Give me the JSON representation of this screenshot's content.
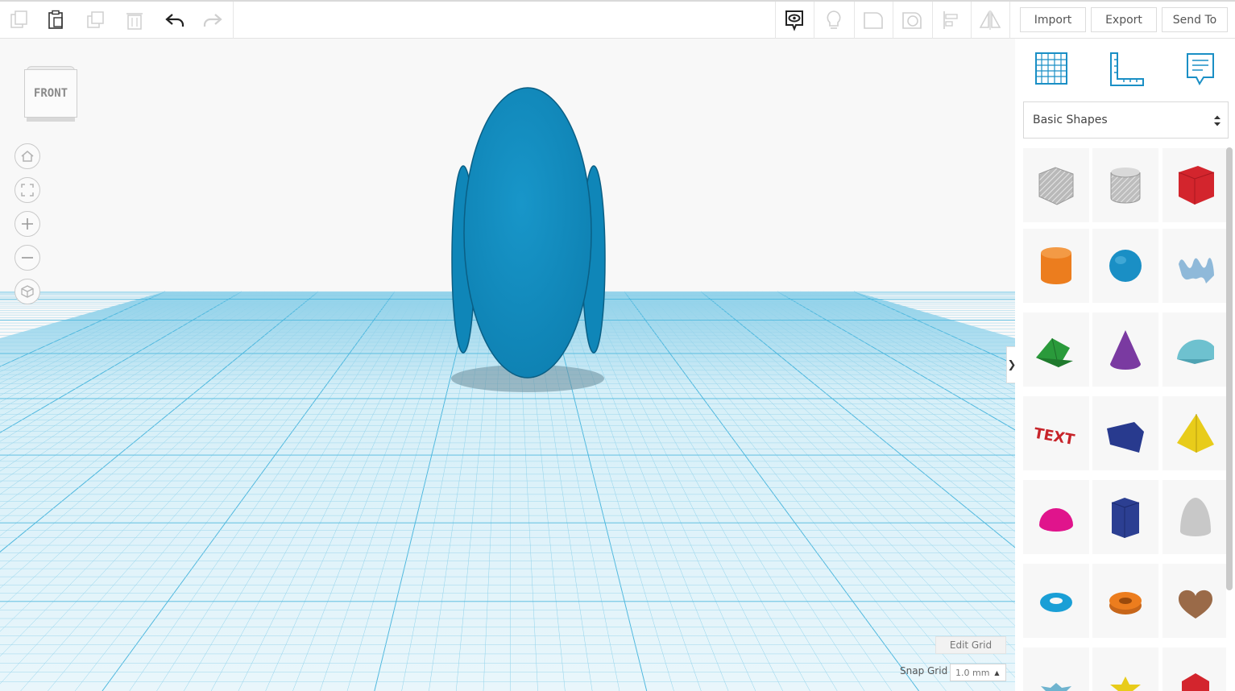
{
  "toolbar": {
    "left_icons": [
      "copy-icon",
      "paste-icon",
      "duplicate-icon",
      "trash-icon",
      "undo-icon",
      "redo-icon"
    ],
    "right_icons": [
      "view-notes-icon",
      "lightbulb-icon",
      "shape-icon",
      "hole-icon",
      "align-icon",
      "mirror-icon"
    ],
    "import_label": "Import",
    "export_label": "Export",
    "send_label": "Send To"
  },
  "viewcube": {
    "label": "FRONT"
  },
  "nav_buttons": [
    "home-icon",
    "fit-view-icon",
    "zoom-in-icon",
    "zoom-out-icon",
    "perspective-icon"
  ],
  "panel": {
    "category": "Basic Shapes",
    "collapse_glyph": "❯",
    "shapes": [
      {
        "name": "box-hole",
        "color": "#b9b9b9"
      },
      {
        "name": "cylinder-hole",
        "color": "#bdbdbd"
      },
      {
        "name": "box",
        "color": "#d3252d"
      },
      {
        "name": "cylinder",
        "color": "#ec7d1e"
      },
      {
        "name": "sphere",
        "color": "#1a8fc5"
      },
      {
        "name": "scribble",
        "color": "#8fb9d9"
      },
      {
        "name": "roof",
        "color": "#2a9a3b"
      },
      {
        "name": "cone",
        "color": "#7a3aa1"
      },
      {
        "name": "round-roof",
        "color": "#6ec1cf"
      },
      {
        "name": "text",
        "color": "#c7242a"
      },
      {
        "name": "wedge",
        "color": "#283a8e"
      },
      {
        "name": "pyramid",
        "color": "#e8cc1a"
      },
      {
        "name": "half-sphere",
        "color": "#e0148c"
      },
      {
        "name": "polygon",
        "color": "#2c3f92"
      },
      {
        "name": "paraboloid",
        "color": "#c8c8c8"
      },
      {
        "name": "torus",
        "color": "#1a9fd6"
      },
      {
        "name": "tube",
        "color": "#ec7d1e"
      },
      {
        "name": "heart",
        "color": "#9a6a48"
      },
      {
        "name": "star",
        "color": "#6fb4cf"
      },
      {
        "name": "star-yellow",
        "color": "#e8cc1a"
      },
      {
        "name": "icosahedron",
        "color": "#d3252d"
      }
    ]
  },
  "grid": {
    "edit_label": "Edit Grid",
    "snap_label": "Snap Grid",
    "snap_value": "1.0 mm"
  },
  "colors": {
    "accent": "#1a8fc5",
    "object": "#1a8fc5",
    "grid": "#7fd0ea"
  }
}
